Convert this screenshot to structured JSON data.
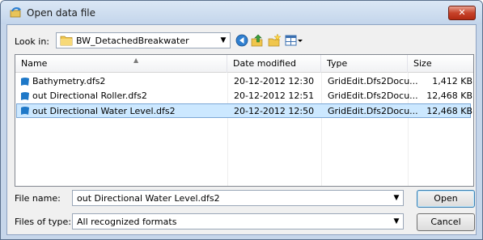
{
  "window": {
    "title": "Open data file",
    "close_glyph": "✕",
    "title_icon": "open-folder-arrow-icon"
  },
  "lookin": {
    "label": "Look in:",
    "value": "BW_DetachedBreakwater",
    "folder_icon": "yellow-folder-icon"
  },
  "toolbar": {
    "buttons": [
      "back-icon",
      "up-folder-icon",
      "new-folder-icon",
      "view-menu-icon"
    ]
  },
  "file_list": {
    "columns": [
      "Name",
      "Date modified",
      "Type",
      "Size"
    ],
    "rows": [
      {
        "name": "Bathymetry.dfs2",
        "date": "20-12-2012 12:30",
        "type": "GridEdit.Dfs2Docu...",
        "size": "1,412 KB",
        "selected": false
      },
      {
        "name": "out Directional Roller.dfs2",
        "date": "20-12-2012 12:51",
        "type": "GridEdit.Dfs2Docu...",
        "size": "12,468 KB",
        "selected": false
      },
      {
        "name": "out Directional Water Level.dfs2",
        "date": "20-12-2012 12:50",
        "type": "GridEdit.Dfs2Docu...",
        "size": "12,468 KB",
        "selected": true
      }
    ]
  },
  "filename": {
    "label": "File name:",
    "value": "out Directional Water Level.dfs2"
  },
  "filetype": {
    "label": "Files of type:",
    "value": "All recognized formats"
  },
  "buttons": {
    "open": "Open",
    "cancel": "Cancel"
  },
  "colors": {
    "selection": "#cce8ff",
    "close_button": "#c7432a",
    "file_icon": "#1e78c8"
  }
}
